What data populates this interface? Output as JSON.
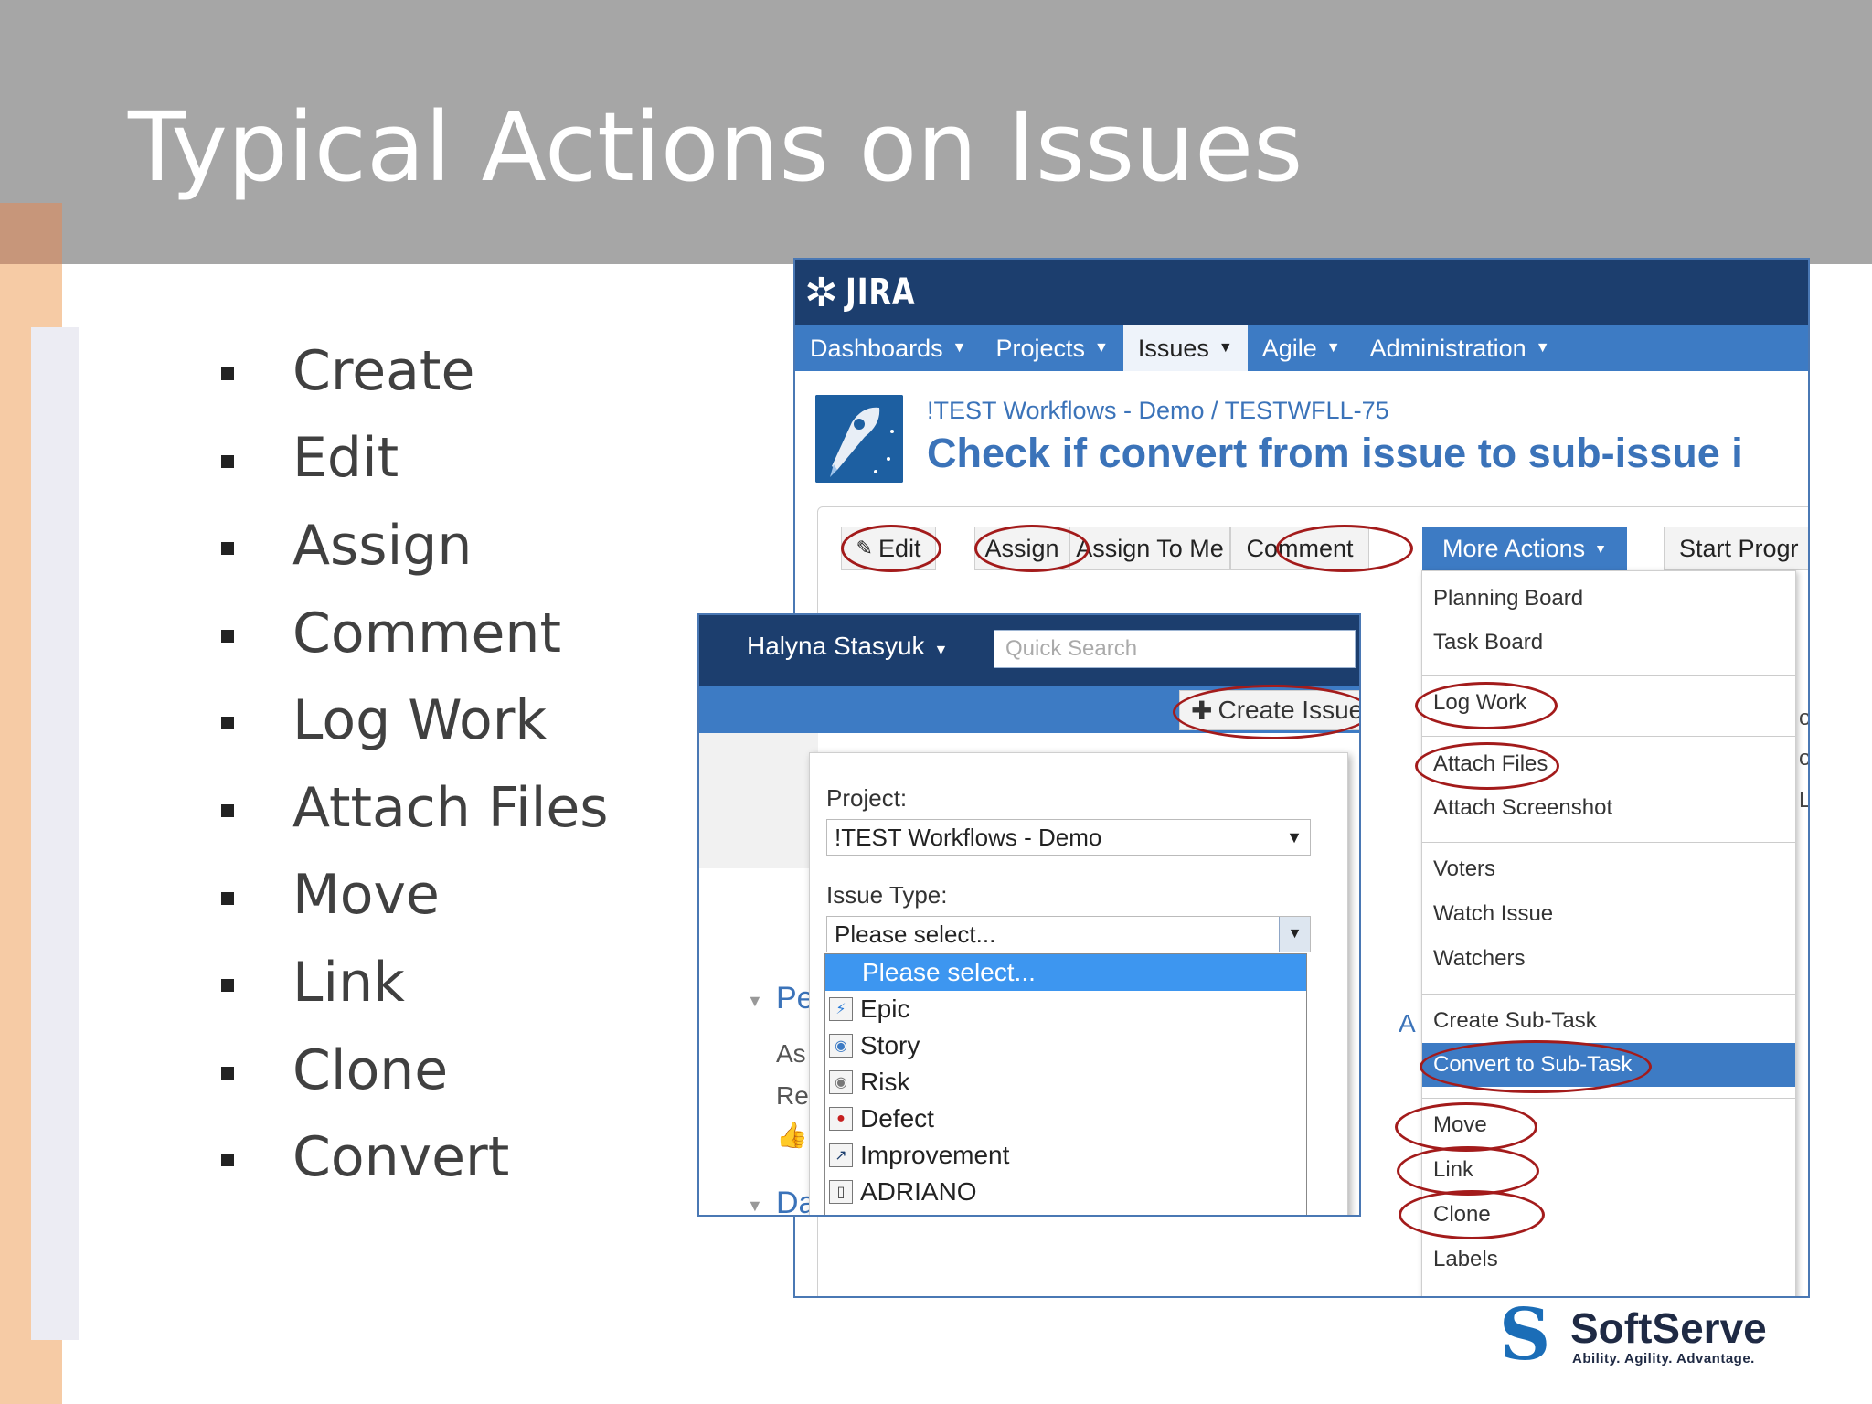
{
  "slide": {
    "title": "Typical Actions on Issues",
    "bullets": [
      "Create",
      "Edit",
      "Assign",
      "Comment",
      "Log Work",
      "Attach Files",
      "Move",
      "Link",
      "Clone",
      "Convert"
    ]
  },
  "jira": {
    "logo_text": "JIRA",
    "nav": [
      {
        "label": "Dashboards",
        "active": false
      },
      {
        "label": "Projects",
        "active": false
      },
      {
        "label": "Issues",
        "active": true
      },
      {
        "label": "Agile",
        "active": false
      },
      {
        "label": "Administration",
        "active": false
      }
    ],
    "breadcrumb": "!TEST Workflows - Demo / TESTWFLL-75",
    "issue_title": "Check if convert from issue to sub-issue i",
    "toolbar": {
      "edit": "Edit",
      "assign": "Assign",
      "assign_to_me": "Assign To Me",
      "comment": "Comment",
      "more_actions": "More Actions",
      "start_progress": "Start Progr"
    },
    "more_actions_menu": [
      "Planning Board",
      "Task Board",
      "Log Work",
      "Attach Files",
      "Attach Screenshot",
      "Voters",
      "Watch Issue",
      "Watchers",
      "Create Sub-Task",
      "Convert to Sub-Task",
      "Move",
      "Link",
      "Clone",
      "Labels"
    ],
    "fragments": {
      "people_heading": "Pe",
      "assignee_frag": "As",
      "reporter_frag": "Rep",
      "dates_heading": "Dat",
      "activity_frag": "A"
    }
  },
  "create_issue": {
    "user": "Halyna Stasyuk",
    "search_placeholder": "Quick Search",
    "create_button": "Create Issue",
    "project_label": "Project:",
    "project_value": "!TEST Workflows - Demo",
    "issue_type_label": "Issue Type:",
    "issue_type_value": "Please select...",
    "issue_types": [
      "Please select...",
      "Epic",
      "Story",
      "Risk",
      "Defect",
      "Improvement",
      "ADRIANO"
    ]
  },
  "brand": {
    "name": "SoftServe",
    "tagline": "Ability. Agility. Advantage."
  },
  "colors": {
    "title_band": "#a6a6a6",
    "jira_dark": "#1c3e6e",
    "jira_blue": "#3d7bc4",
    "highlight_ring": "#a31b1b"
  }
}
